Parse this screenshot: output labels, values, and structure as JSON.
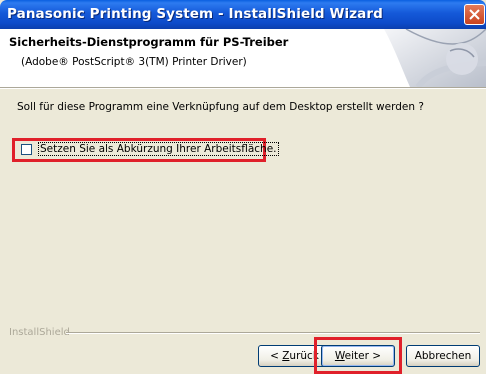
{
  "window": {
    "title": "Panasonic Printing System - InstallShield Wizard"
  },
  "header": {
    "title": "Sicherheits-Dienstprogramm für PS-Treiber",
    "subtitle": "(Adobe® PostScript® 3(TM) Printer Driver)"
  },
  "body": {
    "question": "Soll für diese Programm eine Verknüpfung auf dem Desktop erstellt werden ?",
    "checkbox_label": "Setzen Sie als Abkürzung Ihrer Arbeitsfläche.",
    "checkbox_checked": false
  },
  "footer": {
    "brand": "InstallShield"
  },
  "buttons": {
    "back_prefix": "< ",
    "back_accel": "Z",
    "back_rest": "urück",
    "next_accel": "W",
    "next_rest": "eiter >",
    "cancel": "Abbrechen"
  },
  "colors": {
    "titlebar": "#0d4bc9",
    "highlight": "#e0202a",
    "dialog_bg": "#ece9d8"
  }
}
